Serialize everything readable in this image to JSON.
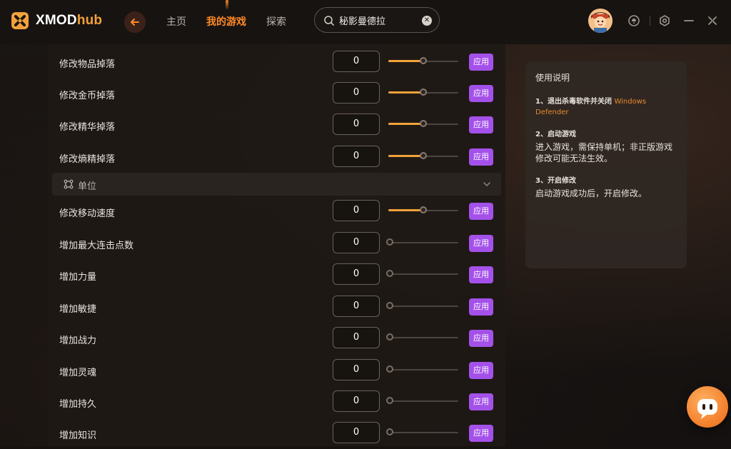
{
  "app": {
    "logo_main": "XMOD",
    "logo_sub": "hub"
  },
  "nav": {
    "items": [
      {
        "label": "主页"
      },
      {
        "label": "我的游戏"
      },
      {
        "label": "探索"
      }
    ],
    "active_index": 1
  },
  "search": {
    "value": "秘影曼德拉",
    "placeholder": ""
  },
  "rows_top": [
    {
      "label": "修改物品掉落",
      "value": "0",
      "level": 0.5
    },
    {
      "label": "修改金币掉落",
      "value": "0",
      "level": 0.5
    },
    {
      "label": "修改精华掉落",
      "value": "0",
      "level": 0.5
    },
    {
      "label": "修改熵精掉落",
      "value": "0",
      "level": 0.5
    }
  ],
  "section": {
    "label": "单位"
  },
  "rows_bottom": [
    {
      "label": "修改移动速度",
      "value": "0",
      "level": 0.5
    },
    {
      "label": "增加最大连击点数",
      "value": "0",
      "level": 0
    },
    {
      "label": "增加力量",
      "value": "0",
      "level": 0
    },
    {
      "label": "增加敏捷",
      "value": "0",
      "level": 0
    },
    {
      "label": "增加战力",
      "value": "0",
      "level": 0
    },
    {
      "label": "增加灵魂",
      "value": "0",
      "level": 0
    },
    {
      "label": "增加持久",
      "value": "0",
      "level": 0
    },
    {
      "label": "增加知识",
      "value": "0",
      "level": 0
    }
  ],
  "apply_label": "应用",
  "info": {
    "title": "使用说明",
    "step1_head": "1、退出杀毒软件并关闭",
    "step1_highlight": "Windows Defender",
    "step2_head": "2、启动游戏",
    "step2_body": "进入游戏，需保持单机；非正版游戏修改可能无法生效。",
    "step3_head": "3、开启修改",
    "step3_body": "启动游戏成功后，开启修改。"
  },
  "colors": {
    "accent": "#ff8a28",
    "apply": "#a451ea",
    "slider_fill": "#f2a23a",
    "highlight": "#e78a2d"
  },
  "icons": {
    "logo": "xmod-logo-icon",
    "back": "back-arrow-icon",
    "search": "search-icon",
    "clear": "clear-icon",
    "notify": "notification-icon",
    "settings": "gear-icon",
    "minimize": "minimize-icon",
    "close": "close-icon",
    "section": "unit-icon",
    "chevron": "chevron-down-icon",
    "helper": "assistant-icon"
  }
}
